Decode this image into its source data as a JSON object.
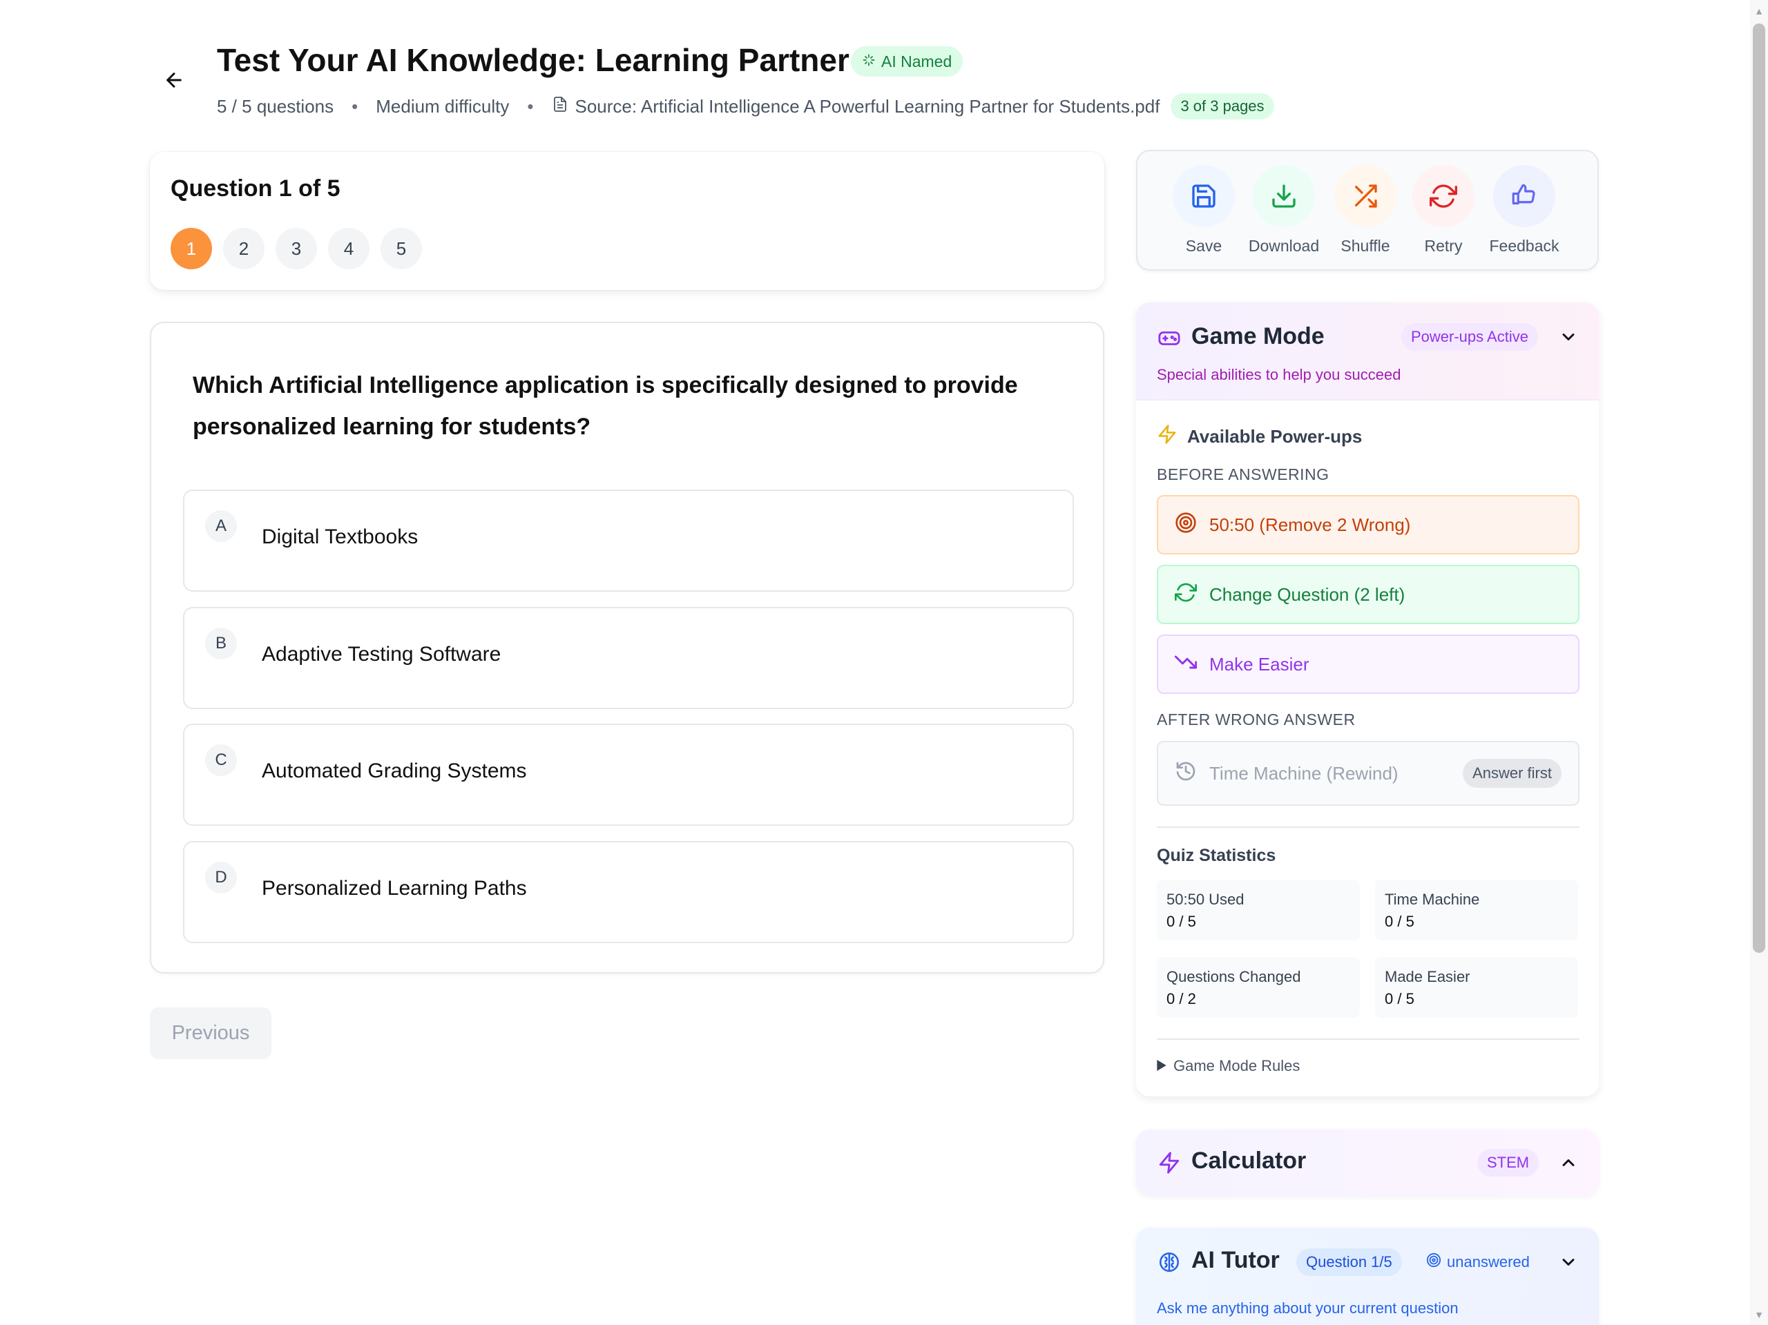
{
  "header": {
    "title": "Test Your AI Knowledge: Learning Partner",
    "ai_badge": "AI Named",
    "question_count": "5 / 5 questions",
    "difficulty": "Medium difficulty",
    "source": "Source: Artificial Intelligence A Powerful Learning Partner for Students.pdf",
    "pages": "3 of 3 pages",
    "separator": "•"
  },
  "question_nav": {
    "title": "Question 1 of 5",
    "numbers": [
      "1",
      "2",
      "3",
      "4",
      "5"
    ],
    "active_index": 0
  },
  "question": {
    "text": "Which Artificial Intelligence application is specifically designed to provide personalized learning for students?",
    "options": [
      {
        "letter": "A",
        "text": "Digital Textbooks"
      },
      {
        "letter": "B",
        "text": "Adaptive Testing Software"
      },
      {
        "letter": "C",
        "text": "Automated Grading Systems"
      },
      {
        "letter": "D",
        "text": "Personalized Learning Paths"
      }
    ]
  },
  "navigation": {
    "previous_label": "Previous"
  },
  "toolbar": {
    "save": "Save",
    "download": "Download",
    "shuffle": "Shuffle",
    "retry": "Retry",
    "feedback": "Feedback"
  },
  "game_mode": {
    "title": "Game Mode",
    "status": "Power-ups Active",
    "subtitle": "Special abilities to help you succeed",
    "powerups_title": "Available Power-ups",
    "before_label": "BEFORE ANSWERING",
    "fifty_fifty": "50:50 (Remove 2 Wrong)",
    "change_question": "Change Question (2 left)",
    "make_easier": "Make Easier",
    "after_label": "AFTER WRONG ANSWER",
    "time_machine": "Time Machine (Rewind)",
    "answer_first": "Answer first",
    "stats_title": "Quiz Statistics",
    "stats": [
      {
        "label": "50:50 Used",
        "value": "0 / 5"
      },
      {
        "label": "Time Machine",
        "value": "0 / 5"
      },
      {
        "label": "Questions Changed",
        "value": "0 / 2"
      },
      {
        "label": "Made Easier",
        "value": "0 / 5"
      }
    ],
    "rules": "Game Mode Rules"
  },
  "calculator": {
    "title": "Calculator",
    "badge": "STEM"
  },
  "ai_tutor": {
    "title": "AI Tutor",
    "question_badge": "Question 1/5",
    "status": "unanswered",
    "subtitle": "Ask me anything about your current question"
  },
  "colors": {
    "accent_orange": "#fb923c",
    "game_purple": "#9333ea",
    "tutor_blue": "#2563eb",
    "success_green": "#15803d"
  }
}
